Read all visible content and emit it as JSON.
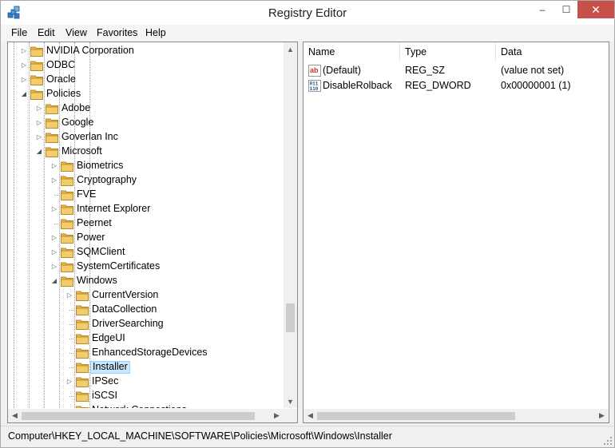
{
  "window": {
    "title": "Registry Editor",
    "minimize": "–",
    "maximize": "☐",
    "close": "✕"
  },
  "menu": [
    "File",
    "Edit",
    "View",
    "Favorites",
    "Help"
  ],
  "tree": [
    {
      "label": "NVIDIA Corporation",
      "level": 3,
      "expander": "collapsed"
    },
    {
      "label": "ODBC",
      "level": 3,
      "expander": "collapsed"
    },
    {
      "label": "Oracle",
      "level": 3,
      "expander": "collapsed"
    },
    {
      "label": "Policies",
      "level": 3,
      "expander": "expanded"
    },
    {
      "label": "Adobe",
      "level": 4,
      "expander": "collapsed"
    },
    {
      "label": "Google",
      "level": 4,
      "expander": "collapsed"
    },
    {
      "label": "Goverlan Inc",
      "level": 4,
      "expander": "collapsed"
    },
    {
      "label": "Microsoft",
      "level": 4,
      "expander": "expanded"
    },
    {
      "label": "Biometrics",
      "level": 5,
      "expander": "collapsed"
    },
    {
      "label": "Cryptography",
      "level": 5,
      "expander": "collapsed"
    },
    {
      "label": "FVE",
      "level": 5,
      "expander": "none"
    },
    {
      "label": "Internet Explorer",
      "level": 5,
      "expander": "collapsed"
    },
    {
      "label": "Peernet",
      "level": 5,
      "expander": "none"
    },
    {
      "label": "Power",
      "level": 5,
      "expander": "collapsed"
    },
    {
      "label": "SQMClient",
      "level": 5,
      "expander": "collapsed"
    },
    {
      "label": "SystemCertificates",
      "level": 5,
      "expander": "collapsed"
    },
    {
      "label": "Windows",
      "level": 5,
      "expander": "expanded"
    },
    {
      "label": "CurrentVersion",
      "level": 6,
      "expander": "collapsed"
    },
    {
      "label": "DataCollection",
      "level": 6,
      "expander": "none"
    },
    {
      "label": "DriverSearching",
      "level": 6,
      "expander": "none"
    },
    {
      "label": "EdgeUI",
      "level": 6,
      "expander": "none"
    },
    {
      "label": "EnhancedStorageDevices",
      "level": 6,
      "expander": "none"
    },
    {
      "label": "Installer",
      "level": 6,
      "expander": "none",
      "selected": true
    },
    {
      "label": "IPSec",
      "level": 6,
      "expander": "collapsed"
    },
    {
      "label": "iSCSI",
      "level": 6,
      "expander": "none"
    },
    {
      "label": "Network Connections",
      "level": 6,
      "expander": "none"
    }
  ],
  "list": {
    "columns": [
      "Name",
      "Type",
      "Data"
    ],
    "rows": [
      {
        "icon": "string-value-icon",
        "name": "(Default)",
        "type": "REG_SZ",
        "data": "(value not set)"
      },
      {
        "icon": "dword-value-icon",
        "name": "DisableRolback",
        "type": "REG_DWORD",
        "data": "0x00000001 (1)"
      }
    ]
  },
  "status": {
    "path": "Computer\\HKEY_LOCAL_MACHINE\\SOFTWARE\\Policies\\Microsoft\\Windows\\Installer"
  },
  "colors": {
    "selection": "#cce8ff",
    "selection_border": "#99d1ff",
    "close_button": "#c7504a",
    "folder": "#e8b84a"
  },
  "scrollbars": {
    "tree_vertical_position": 0.8,
    "tree_horizontal_position": 0.0,
    "list_horizontal_position": 0.0
  }
}
